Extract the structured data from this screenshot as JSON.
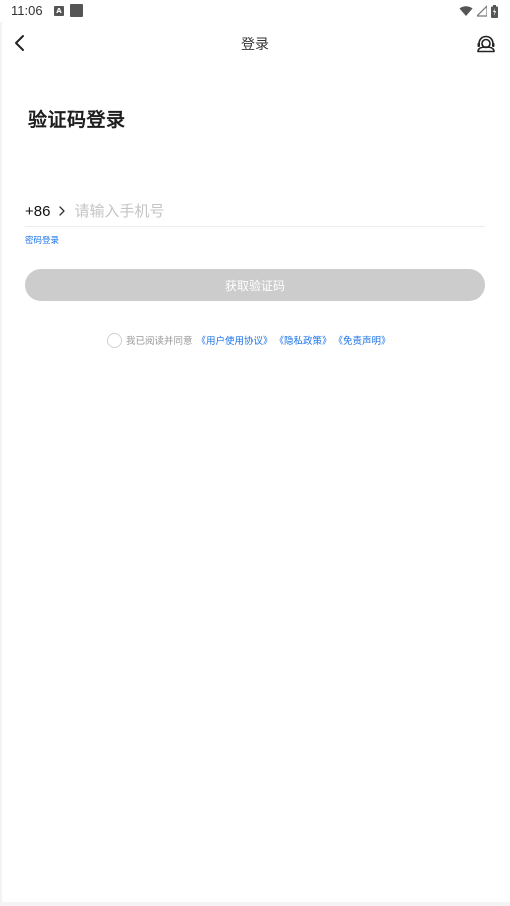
{
  "status_bar": {
    "time": "11:06",
    "notification_icon_letter": "A",
    "icons": [
      "a-notification-icon",
      "square-notification-icon",
      "wifi-icon",
      "signal-icon",
      "battery-icon"
    ]
  },
  "header": {
    "title": "登录",
    "back_icon": "chevron-left-icon",
    "support_icon": "headset-icon"
  },
  "main": {
    "heading": "验证码登录",
    "country_code": "+86",
    "phone_placeholder": "请输入手机号",
    "phone_value": "",
    "password_login_link": "密码登录",
    "get_code_button": "获取验证码"
  },
  "agreement": {
    "prefix": "我已阅读并同意",
    "links": [
      "《用户使用协议》",
      "《隐私政策》",
      "《免责声明》"
    ],
    "checked": false
  },
  "colors": {
    "link": "#1a73e8",
    "button_disabled": "#cccccc",
    "placeholder": "#c4c4c4"
  }
}
